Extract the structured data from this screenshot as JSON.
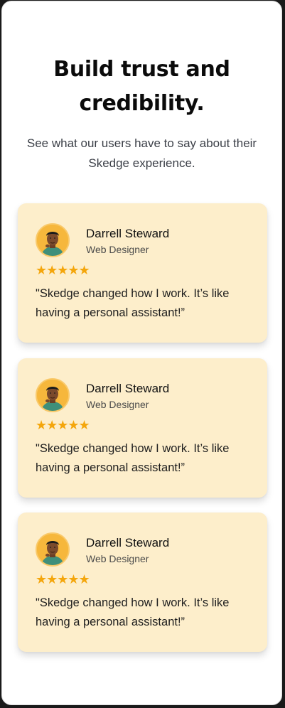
{
  "heading": "Build trust and credibility.",
  "subtitle": "See what our users have to say about their Skedge experience.",
  "colors": {
    "card_bg": "#fdeecb",
    "star": "#f4a60c",
    "avatar_bg": "#f6b73c"
  },
  "testimonials": [
    {
      "name": "Darrell Steward",
      "role": "Web Designer",
      "rating": 5,
      "stars": "★★★★★",
      "quote": "\"Skedge changed how I work. It’s like having a personal assistant!”",
      "avatar_icon": "user-avatar-photo"
    },
    {
      "name": "Darrell Steward",
      "role": "Web Designer",
      "rating": 5,
      "stars": "★★★★★",
      "quote": "\"Skedge changed how I work. It’s like having a personal assistant!”",
      "avatar_icon": "user-avatar-photo"
    },
    {
      "name": "Darrell Steward",
      "role": "Web Designer",
      "rating": 5,
      "stars": "★★★★★",
      "quote": "\"Skedge changed how I work. It’s like having a personal assistant!”",
      "avatar_icon": "user-avatar-photo"
    }
  ]
}
